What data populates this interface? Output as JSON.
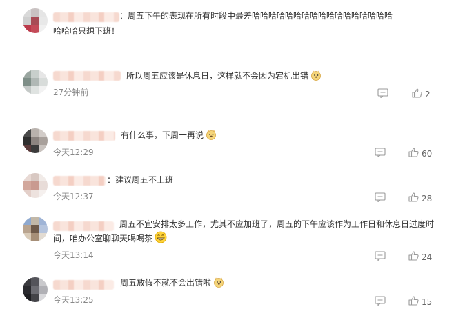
{
  "comments": [
    {
      "text_line1": "：周五下午的表现在所有时段中最差哈哈哈哈哈哈哈哈哈哈哈哈哈哈哈哈哈",
      "text_line2": "哈哈哈只想下班！",
      "time": "",
      "likes": ""
    },
    {
      "text_line1": "所以周五应该是休息日，这样就不会因为宕机出错",
      "time": "27分钟前",
      "likes": "2",
      "emoji": "doge-emoji"
    },
    {
      "text_line1": "有什么事，下周一再说",
      "time": "今天12:29",
      "likes": "60",
      "emoji": "doge-emoji"
    },
    {
      "text_line1": "：建议周五不上班",
      "time": "今天12:37",
      "likes": "28"
    },
    {
      "text_line1": "周五不宜安排太多工作，尤其不应加班了，周五的下午应该作为工作日和休息日过度时",
      "text_line2": "间，咱办公室聊聊天喝喝茶",
      "time": "今天13:14",
      "likes": "24",
      "emoji": "grin-emoji"
    },
    {
      "text_line1": "周五放假不就不会出错啦",
      "time": "今天13:25",
      "likes": "15",
      "emoji": "doge-emoji"
    }
  ],
  "colors": {
    "text": "#333333",
    "time": "#888888",
    "icon": "#999999"
  },
  "icons": {
    "comment": "comment-icon",
    "like": "thumbs-up-icon"
  }
}
